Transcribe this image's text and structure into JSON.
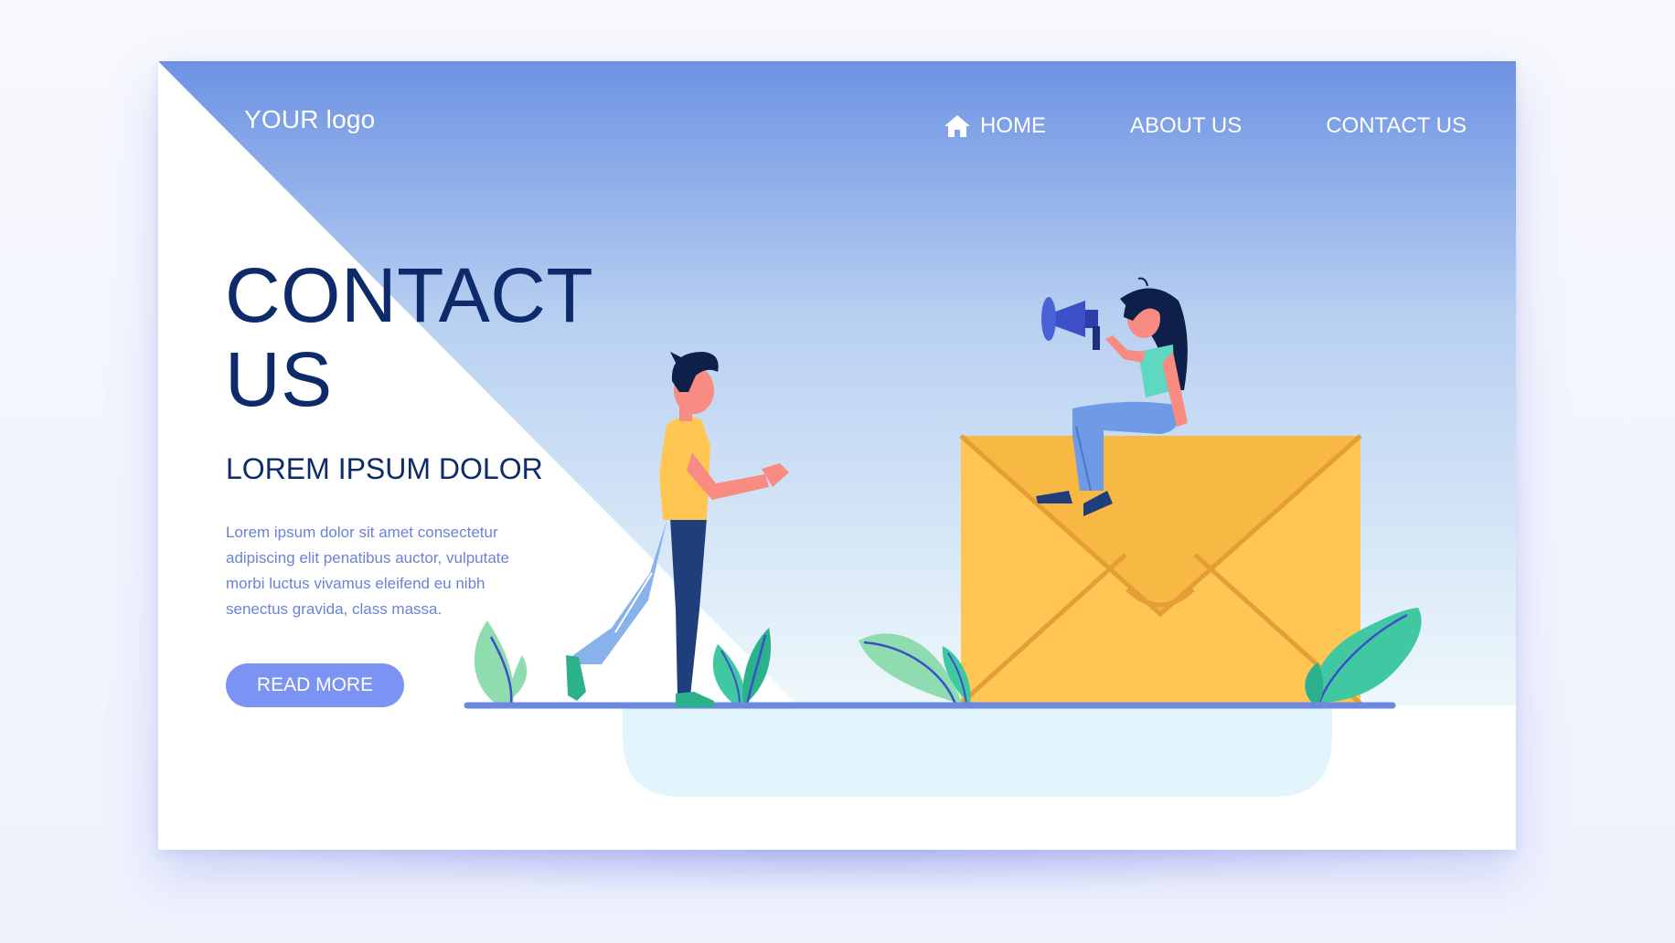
{
  "header": {
    "logo_text": "YOUR logo",
    "nav": {
      "home": "HOME",
      "about": "ABOUT US",
      "contact": "CONTACT US"
    }
  },
  "hero": {
    "title": "CONTACT US",
    "subtitle": "LOREM IPSUM DOLOR",
    "body": "Lorem ipsum dolor sit amet consectetur adipiscing elit penatibus auctor, vulputate morbi luctus vivamus eleifend eu nibh senectus gravida, class massa.",
    "button_label": "READ MORE"
  },
  "colors": {
    "header_gradient_top": "#6d92e3",
    "header_gradient_bottom": "#e8f4fb",
    "title_navy": "#0d2a6b",
    "body_text_blue": "#6b82d6",
    "button_blue": "#7b93f3",
    "envelope_yellow": "#ffc654",
    "leaf_green": "#3fc8a1",
    "ground_line": "#6d88e0"
  },
  "icons": {
    "home": "home-icon",
    "megaphone": "megaphone-icon",
    "envelope": "envelope-icon"
  }
}
